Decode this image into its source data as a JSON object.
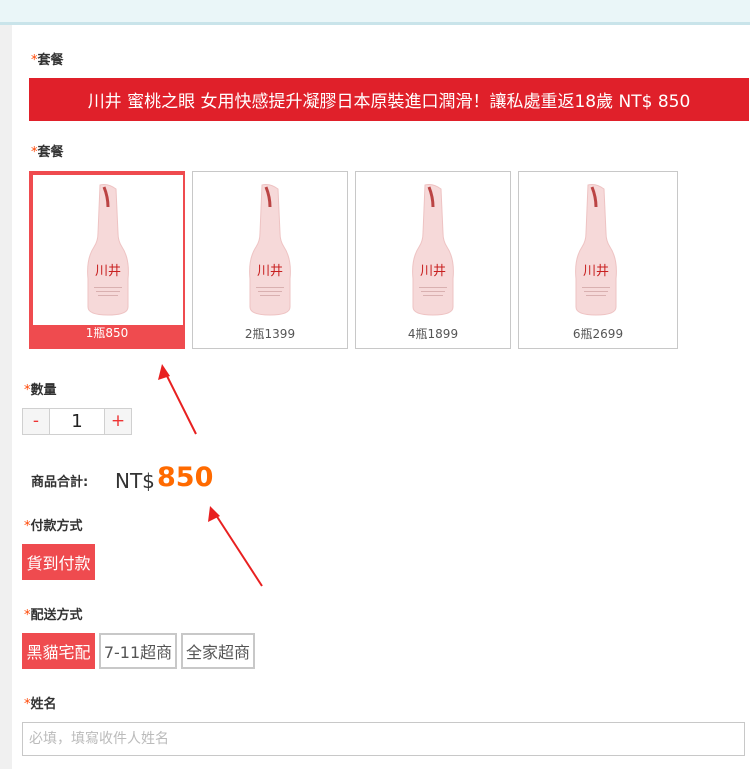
{
  "colors": {
    "accent": "#ef4b4f",
    "banner": "#e0202a",
    "price": "#ff6a00",
    "required_star": "#ff4400"
  },
  "package_banner_label": "套餐",
  "banner_text": "川井 蜜桃之眼 女用快感提升凝膠日本原裝進口潤滑！讓私處重返18歲 NT$ 850",
  "package_select_label": "套餐",
  "packages": [
    {
      "caption": "1瓶850",
      "selected": true
    },
    {
      "caption": "2瓶1399",
      "selected": false
    },
    {
      "caption": "4瓶1899",
      "selected": false
    },
    {
      "caption": "6瓶2699",
      "selected": false
    }
  ],
  "quantity": {
    "label": "數量",
    "minus": "-",
    "value": "1",
    "plus": "+"
  },
  "total": {
    "label": "商品合計:",
    "currency": "NT$",
    "amount": "850"
  },
  "payment": {
    "label": "付款方式",
    "options": [
      "貨到付款"
    ]
  },
  "shipping": {
    "label": "配送方式",
    "options": [
      "黑貓宅配",
      "7-11超商",
      "全家超商"
    ]
  },
  "name": {
    "label": "姓名",
    "placeholder": "必填，填寫收件人姓名"
  },
  "required_mark": "*"
}
